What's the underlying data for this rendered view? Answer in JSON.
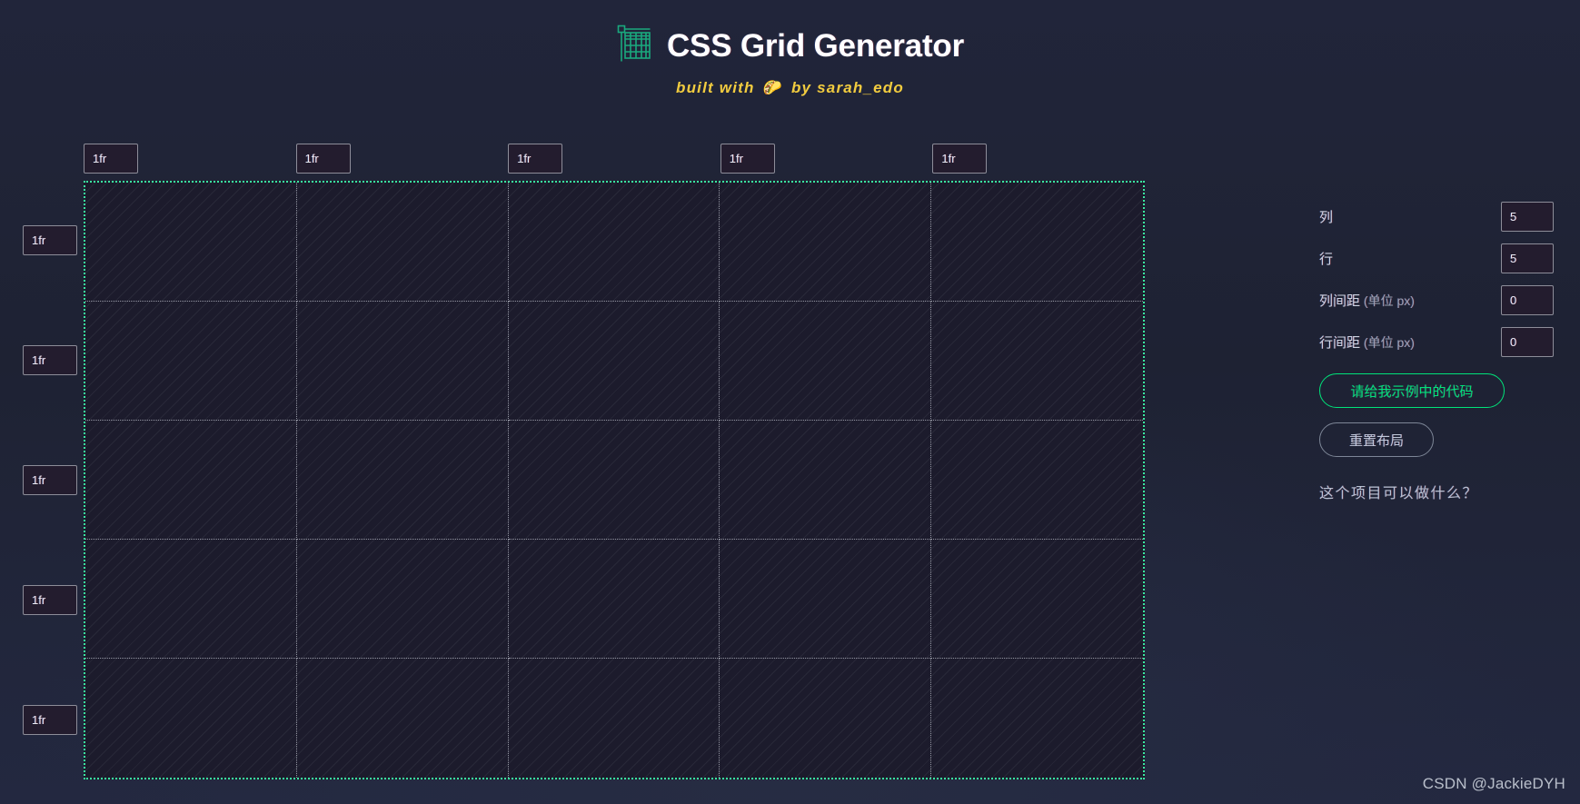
{
  "header": {
    "logo_icon": "grid-table-icon",
    "title": "CSS Grid Generator",
    "subtitle_before": "built with",
    "subtitle_emoji": "🌮",
    "subtitle_after": "by sarah_edo"
  },
  "grid": {
    "columns": 5,
    "rows": 5,
    "column_sizes": [
      "1fr",
      "1fr",
      "1fr",
      "1fr",
      "1fr"
    ],
    "row_sizes": [
      "1fr",
      "1fr",
      "1fr",
      "1fr",
      "1fr"
    ],
    "border_color": "#3ae8a0",
    "cell_divider_color": "#dee2ec",
    "fill_color": "#1c1b2c"
  },
  "sidebar": {
    "controls": [
      {
        "label": "列",
        "unit": "",
        "value": "5",
        "name": "columns"
      },
      {
        "label": "行",
        "unit": "",
        "value": "5",
        "name": "rows"
      },
      {
        "label": "列间距",
        "unit": " (单位 px)",
        "value": "0",
        "name": "column-gap"
      },
      {
        "label": "行间距",
        "unit": " (单位 px)",
        "value": "0",
        "name": "row-gap"
      }
    ],
    "primary_button": "请给我示例中的代码",
    "secondary_button": "重置布局",
    "help_link": "这个项目可以做什么？",
    "primary_color": "#00e37a"
  },
  "watermark": "CSDN @JackieDYH"
}
